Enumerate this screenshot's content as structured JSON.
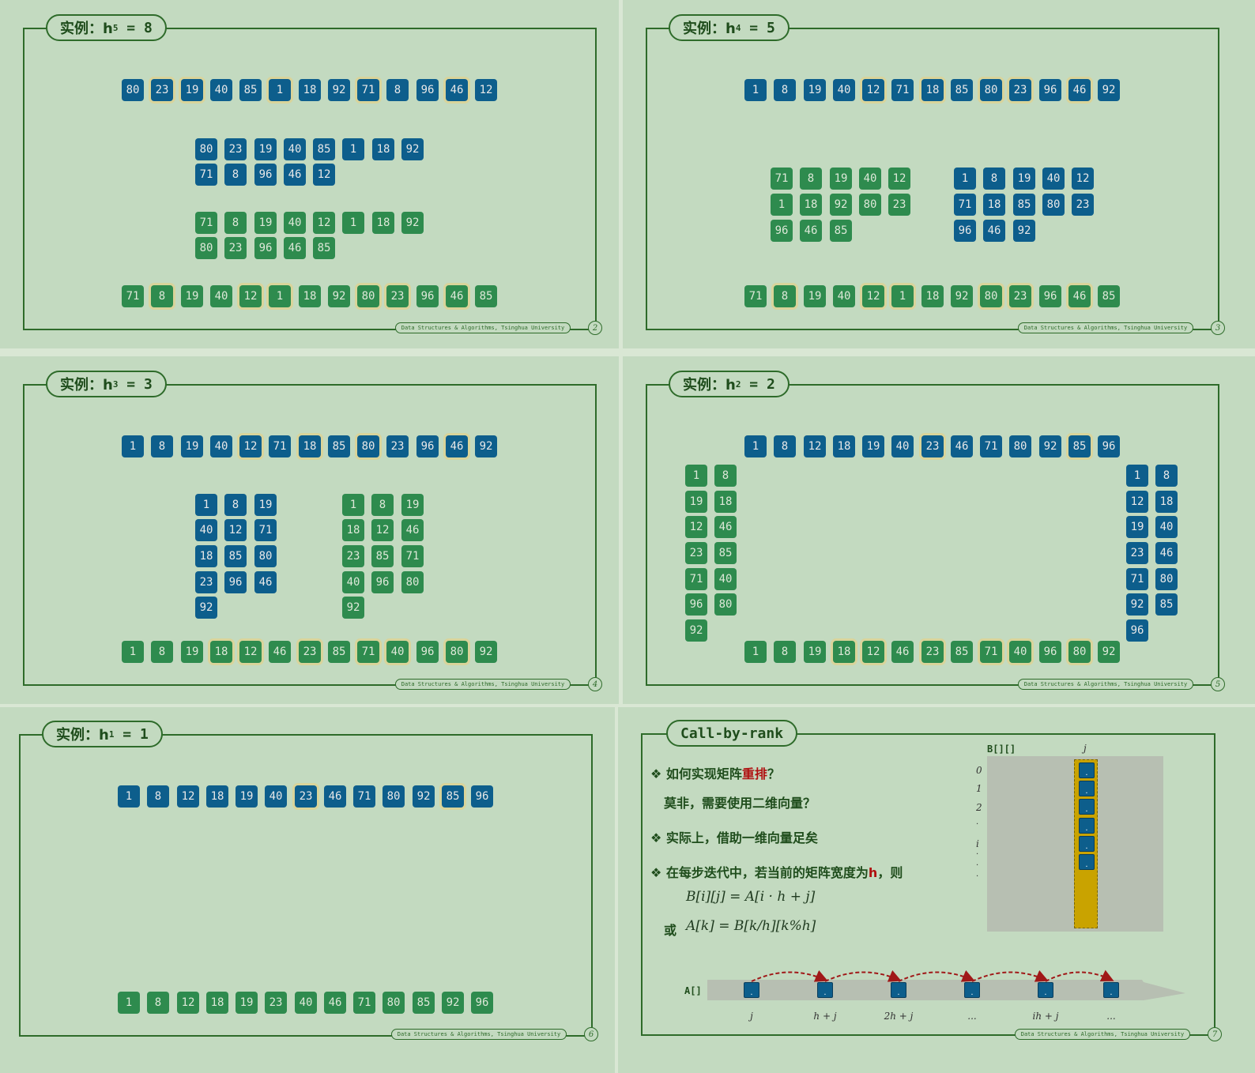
{
  "footer_text": "Data Structures & Algorithms, Tsinghua University",
  "slides": [
    {
      "title_prefix": "实例：h",
      "title_sub": "5",
      "title_rest": " = 8",
      "page": "2",
      "rows": [
        {
          "color": "b",
          "values": [
            "80",
            "23",
            "19",
            "40",
            "85",
            "1",
            "18",
            "92",
            "71",
            "8",
            "96",
            "46",
            "12"
          ],
          "hl": [
            1,
            2,
            5,
            8,
            11
          ]
        },
        {
          "color": "b",
          "values": [
            "80",
            "23",
            "19",
            "40",
            "85",
            "1",
            "18",
            "92"
          ],
          "hl": []
        },
        {
          "color": "b",
          "values": [
            "71",
            "8",
            "96",
            "46",
            "12"
          ],
          "hl": []
        },
        {
          "color": "g",
          "values": [
            "71",
            "8",
            "19",
            "40",
            "12",
            "1",
            "18",
            "92"
          ],
          "hl": []
        },
        {
          "color": "g",
          "values": [
            "80",
            "23",
            "96",
            "46",
            "85"
          ],
          "hl": []
        },
        {
          "color": "g",
          "values": [
            "71",
            "8",
            "19",
            "40",
            "12",
            "1",
            "18",
            "92",
            "80",
            "23",
            "96",
            "46",
            "85"
          ],
          "hl": [
            1,
            4,
            5,
            8,
            9,
            11
          ]
        }
      ]
    },
    {
      "title_prefix": "实例：h",
      "title_sub": "4",
      "title_rest": " = 5",
      "page": "3",
      "rows": [
        {
          "color": "b",
          "values": [
            "1",
            "8",
            "19",
            "40",
            "12",
            "71",
            "18",
            "85",
            "80",
            "23",
            "96",
            "46",
            "92"
          ],
          "hl": [
            4,
            6,
            8,
            9,
            11
          ]
        },
        {
          "color": "g",
          "values": [
            "71",
            "8",
            "19",
            "40",
            "12"
          ],
          "hl": []
        },
        {
          "color": "g",
          "values": [
            "1",
            "18",
            "92",
            "80",
            "23"
          ],
          "hl": []
        },
        {
          "color": "g",
          "values": [
            "96",
            "46",
            "85"
          ],
          "hl": []
        },
        {
          "color": "b",
          "values": [
            "1",
            "8",
            "19",
            "40",
            "12"
          ],
          "hl": []
        },
        {
          "color": "b",
          "values": [
            "71",
            "18",
            "85",
            "80",
            "23"
          ],
          "hl": []
        },
        {
          "color": "b",
          "values": [
            "96",
            "46",
            "92"
          ],
          "hl": []
        },
        {
          "color": "g",
          "values": [
            "71",
            "8",
            "19",
            "40",
            "12",
            "1",
            "18",
            "92",
            "80",
            "23",
            "96",
            "46",
            "85"
          ],
          "hl": [
            1,
            4,
            5,
            8,
            9,
            11
          ]
        }
      ]
    },
    {
      "title_prefix": "实例：h",
      "title_sub": "3",
      "title_rest": " = 3",
      "page": "4",
      "rows": [
        {
          "color": "b",
          "values": [
            "1",
            "8",
            "19",
            "40",
            "12",
            "71",
            "18",
            "85",
            "80",
            "23",
            "96",
            "46",
            "92"
          ],
          "hl": [
            4,
            6,
            8,
            11
          ]
        },
        {
          "color": "b",
          "values": [
            "1",
            "8",
            "19"
          ],
          "hl": []
        },
        {
          "color": "b",
          "values": [
            "40",
            "12",
            "71"
          ],
          "hl": []
        },
        {
          "color": "b",
          "values": [
            "18",
            "85",
            "80"
          ],
          "hl": []
        },
        {
          "color": "b",
          "values": [
            "23",
            "96",
            "46"
          ],
          "hl": []
        },
        {
          "color": "b",
          "values": [
            "92"
          ],
          "hl": []
        },
        {
          "color": "g",
          "values": [
            "1",
            "8",
            "19"
          ],
          "hl": []
        },
        {
          "color": "g",
          "values": [
            "18",
            "12",
            "46"
          ],
          "hl": []
        },
        {
          "color": "g",
          "values": [
            "23",
            "85",
            "71"
          ],
          "hl": []
        },
        {
          "color": "g",
          "values": [
            "40",
            "96",
            "80"
          ],
          "hl": []
        },
        {
          "color": "g",
          "values": [
            "92"
          ],
          "hl": []
        },
        {
          "color": "g",
          "values": [
            "1",
            "8",
            "19",
            "18",
            "12",
            "46",
            "23",
            "85",
            "71",
            "40",
            "96",
            "80",
            "92"
          ],
          "hl": [
            3,
            4,
            6,
            8,
            9,
            11
          ]
        }
      ]
    },
    {
      "title_prefix": "实例：h",
      "title_sub": "2",
      "title_rest": " = 2",
      "page": "5",
      "rows": [
        {
          "color": "b",
          "values": [
            "1",
            "8",
            "12",
            "18",
            "19",
            "40",
            "23",
            "46",
            "71",
            "80",
            "92",
            "85",
            "96"
          ],
          "hl": [
            6,
            11
          ]
        },
        {
          "color": "g",
          "values": [
            "1",
            "8"
          ],
          "hl": []
        },
        {
          "color": "g",
          "values": [
            "19",
            "18"
          ],
          "hl": []
        },
        {
          "color": "g",
          "values": [
            "12",
            "46"
          ],
          "hl": []
        },
        {
          "color": "g",
          "values": [
            "23",
            "85"
          ],
          "hl": []
        },
        {
          "color": "g",
          "values": [
            "71",
            "40"
          ],
          "hl": []
        },
        {
          "color": "g",
          "values": [
            "96",
            "80"
          ],
          "hl": []
        },
        {
          "color": "g",
          "values": [
            "92"
          ],
          "hl": []
        },
        {
          "color": "b",
          "values": [
            "1",
            "8"
          ],
          "hl": []
        },
        {
          "color": "b",
          "values": [
            "12",
            "18"
          ],
          "hl": []
        },
        {
          "color": "b",
          "values": [
            "19",
            "40"
          ],
          "hl": []
        },
        {
          "color": "b",
          "values": [
            "23",
            "46"
          ],
          "hl": []
        },
        {
          "color": "b",
          "values": [
            "71",
            "80"
          ],
          "hl": []
        },
        {
          "color": "b",
          "values": [
            "92",
            "85"
          ],
          "hl": []
        },
        {
          "color": "b",
          "values": [
            "96"
          ],
          "hl": []
        },
        {
          "color": "g",
          "values": [
            "1",
            "8",
            "19",
            "18",
            "12",
            "46",
            "23",
            "85",
            "71",
            "40",
            "96",
            "80",
            "92"
          ],
          "hl": [
            3,
            4,
            6,
            8,
            9,
            11
          ]
        }
      ]
    },
    {
      "title_prefix": "实例：h",
      "title_sub": "1",
      "title_rest": " = 1",
      "page": "6",
      "rows": [
        {
          "color": "b",
          "values": [
            "1",
            "8",
            "12",
            "18",
            "19",
            "40",
            "23",
            "46",
            "71",
            "80",
            "92",
            "85",
            "96"
          ],
          "hl": [
            6,
            11
          ]
        },
        {
          "color": "g",
          "values": [
            "1",
            "8",
            "12",
            "18",
            "19",
            "23",
            "40",
            "46",
            "71",
            "80",
            "85",
            "92",
            "96"
          ],
          "hl": []
        }
      ]
    }
  ],
  "slide7": {
    "title": "Call-by-rank",
    "page": "7",
    "bullet1_pre": "❖ 如何实现矩阵",
    "bullet1_red": "重排",
    "bullet1_post": "？",
    "bullet1_sub": "莫非，需要使用二维向量？",
    "bullet2": "❖ 实际上，借助一维向量足矣",
    "bullet3_pre": "❖ 在每步迭代中，若当前的矩阵宽度为",
    "bullet3_red": "h",
    "bullet3_post": "，则",
    "formula1": "B[i][j] = A[i · h + j]",
    "or_label": "或",
    "formula2": "A[k] = B[k/h][k%h]",
    "matrix_label": "B[][]",
    "col_label": "j",
    "row_labels": [
      "0",
      "1",
      "2",
      "·",
      "i",
      "·",
      "·",
      "·"
    ],
    "array_label": "A[]",
    "array_idx": [
      "j",
      "h + j",
      "2h + j",
      "...",
      "ih + j",
      "..."
    ]
  }
}
